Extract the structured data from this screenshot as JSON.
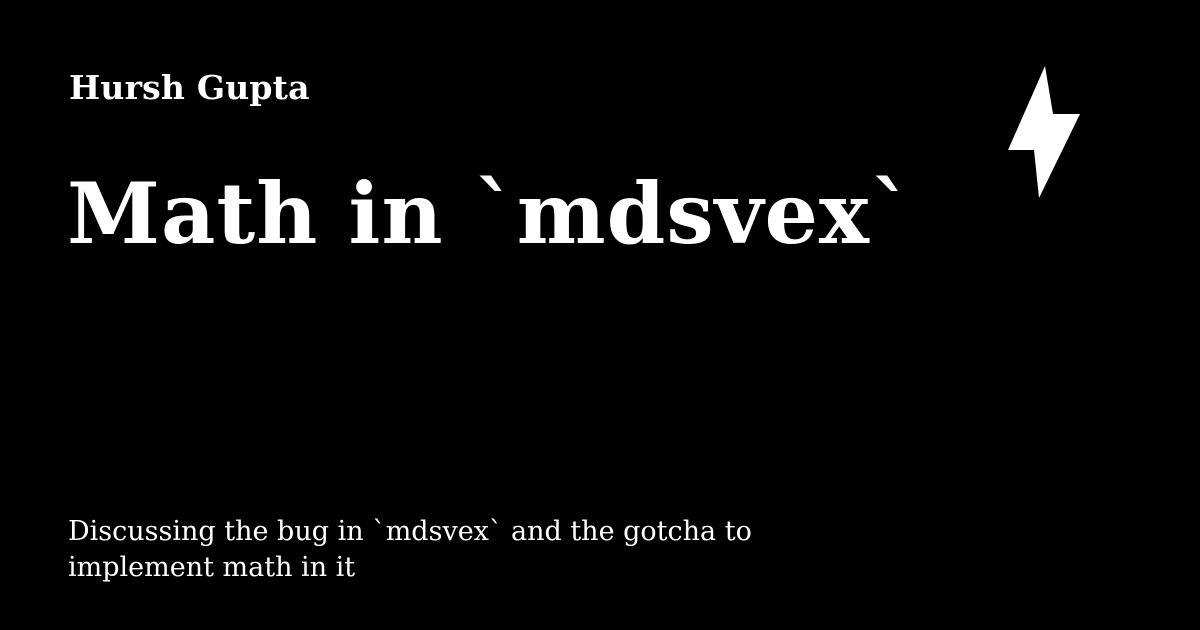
{
  "card": {
    "author": "Hursh Gupta",
    "title": "Math in `mdsvex`",
    "description": "Discussing the bug in `mdsvex` and the gotcha to implement math in it",
    "icon": "lightning-bolt-icon"
  },
  "colors": {
    "background": "#000000",
    "foreground": "#ffffff"
  }
}
